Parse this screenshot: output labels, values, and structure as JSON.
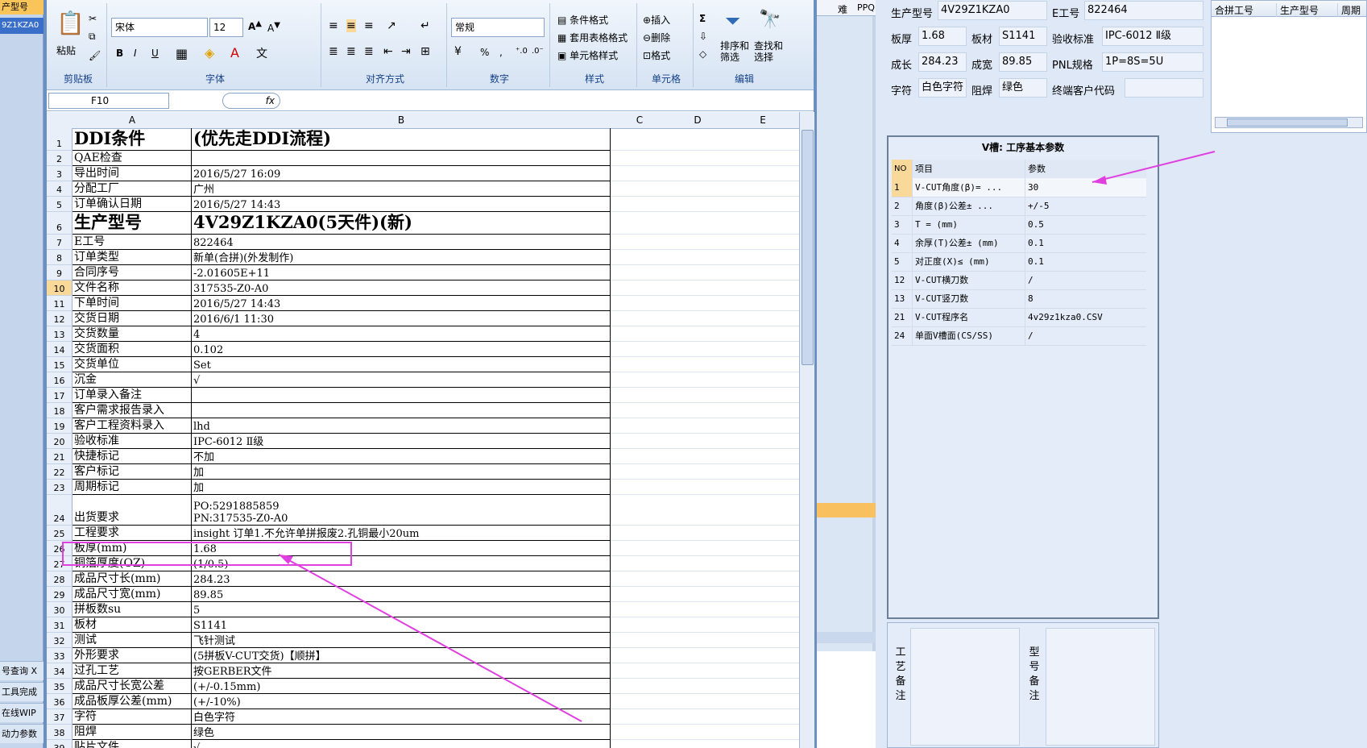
{
  "left_strip": {
    "header": "产型号",
    "selected": "9Z1KZA0",
    "buttons": [
      "号查询 X",
      "工具完成",
      "在线WIP",
      "动力参数"
    ]
  },
  "ribbon": {
    "clipboard": {
      "paste": "粘贴",
      "label": "剪贴板"
    },
    "font": {
      "name": "宋体",
      "size": "12",
      "label": "字体",
      "bold": "B",
      "italic": "I",
      "underline": "U"
    },
    "align": {
      "label": "对齐方式"
    },
    "number": {
      "format": "常规",
      "label": "数字",
      "percent": "%",
      "comma": ","
    },
    "styles": {
      "cond": "条件格式",
      "table": "套用表格格式",
      "cell": "单元格样式",
      "label": "样式"
    },
    "cells": {
      "insert": "插入",
      "delete": "删除",
      "format": "格式",
      "label": "单元格"
    },
    "edit": {
      "sort": "排序和筛选",
      "find": "查找和选择",
      "label": "编辑",
      "sigma": "Σ"
    }
  },
  "formula_bar": {
    "name_box": "F10",
    "fx": "fx"
  },
  "columns": [
    "A",
    "B",
    "C",
    "D",
    "E"
  ],
  "rows": [
    {
      "n": "1",
      "a": "DDI条件",
      "b": "(优先走DDI流程)",
      "big": true
    },
    {
      "n": "2",
      "a": "QAE检查",
      "b": ""
    },
    {
      "n": "3",
      "a": "导出时间",
      "b": "2016/5/27 16:09"
    },
    {
      "n": "4",
      "a": "分配工厂",
      "b": "广州"
    },
    {
      "n": "5",
      "a": "订单确认日期",
      "b": "2016/5/27 14:43"
    },
    {
      "n": "6",
      "a": "生产型号",
      "b": "4V29Z1KZA0(5天件)(新)",
      "big": true
    },
    {
      "n": "7",
      "a": "E工号",
      "b": "822464"
    },
    {
      "n": "8",
      "a": "订单类型",
      "b": "新单(合拼)(外发制作)"
    },
    {
      "n": "9",
      "a": "合同序号",
      "b": "-2.01605E+11"
    },
    {
      "n": "10",
      "a": "文件名称",
      "b": "317535-Z0-A0",
      "sel": true
    },
    {
      "n": "11",
      "a": "下单时间",
      "b": "2016/5/27 14:43"
    },
    {
      "n": "12",
      "a": "交货日期",
      "b": "2016/6/1 11:30"
    },
    {
      "n": "13",
      "a": "交货数量",
      "b": "4"
    },
    {
      "n": "14",
      "a": "交货面积",
      "b": "0.102"
    },
    {
      "n": "15",
      "a": "交货单位",
      "b": "Set"
    },
    {
      "n": "16",
      "a": "沉金",
      "b": "√"
    },
    {
      "n": "17",
      "a": "订单录入备注",
      "b": ""
    },
    {
      "n": "18",
      "a": "客户需求报告录入",
      "b": ""
    },
    {
      "n": "19",
      "a": "客户工程资料录入",
      "b": "lhd"
    },
    {
      "n": "20",
      "a": "验收标准",
      "b": "IPC-6012 Ⅱ级"
    },
    {
      "n": "21",
      "a": "快捷标记",
      "b": "不加"
    },
    {
      "n": "22",
      "a": "客户标记",
      "b": "加"
    },
    {
      "n": "23",
      "a": "周期标记",
      "b": "加"
    },
    {
      "n": "24",
      "a": "出货要求",
      "b": "PO:5291885859",
      "b2": " PN:317535-Z0-A0",
      "tall": true
    },
    {
      "n": "25",
      "a": "工程要求",
      "b": "insight 订单1.不允许单拼报废2.孔铜最小20um"
    },
    {
      "n": "26",
      "a": "板厚(mm)",
      "b": "1.68"
    },
    {
      "n": "27",
      "a": "铜箔厚度(OZ)",
      "b": " (1/0.5)"
    },
    {
      "n": "28",
      "a": "成品尺寸长(mm)",
      "b": "284.23"
    },
    {
      "n": "29",
      "a": "成品尺寸宽(mm)",
      "b": "89.85"
    },
    {
      "n": "30",
      "a": "拼板数su",
      "b": "5"
    },
    {
      "n": "31",
      "a": "板材",
      "b": "S1141"
    },
    {
      "n": "32",
      "a": "测试",
      "b": "飞针测试"
    },
    {
      "n": "33",
      "a": "外形要求",
      "b": "(5拼板V-CUT交货)【顺拼】"
    },
    {
      "n": "34",
      "a": "过孔工艺",
      "b": "按GERBER文件"
    },
    {
      "n": "35",
      "a": "成品尺寸长宽公差",
      "b": "(+/-0.15mm)"
    },
    {
      "n": "36",
      "a": "成品板厚公差(mm)",
      "b": "(+/-10%)"
    },
    {
      "n": "37",
      "a": "字符",
      "b": "白色字符"
    },
    {
      "n": "38",
      "a": "阻焊",
      "b": "绿色"
    },
    {
      "n": "39",
      "a": "贴片文件",
      "b": "√"
    }
  ],
  "mid": {
    "h1": "难",
    "h2": "PPQ"
  },
  "info": {
    "model_label": "生产型号",
    "model_value": "4V29Z1KZA0",
    "e_label": "E工号",
    "e_value": "822464",
    "thick_label": "板厚",
    "thick_value": "1.68",
    "mat_label": "板材",
    "mat_value": "S1141",
    "std_label": "验收标准",
    "std_value": "IPC-6012 Ⅱ级",
    "len_label": "成长",
    "len_value": "284.23",
    "wid_label": "成宽",
    "wid_value": "89.85",
    "pnl_label": "PNL规格",
    "pnl_value": "1P=8S=5U",
    "char_label": "字符",
    "char_value": "白色字符",
    "mask_label": "阻焊",
    "mask_value": "绿色",
    "cust_label": "终端客户代码",
    "cust_value": ""
  },
  "merge_panel": {
    "headers": [
      "合拼工号",
      "生产型号",
      "周期"
    ]
  },
  "vcut": {
    "title": "V槽: 工序基本参数",
    "headers": {
      "no": "NO",
      "item": "项目",
      "val": "参数"
    },
    "rows": [
      {
        "no": "1",
        "item": "V-CUT角度(β)=  ...",
        "val": "30"
      },
      {
        "no": "2",
        "item": "角度(β)公差±  ...",
        "val": "+/-5"
      },
      {
        "no": "3",
        "item": "T =  (mm)",
        "val": "0.5"
      },
      {
        "no": "4",
        "item": "余厚(T)公差±  (mm)",
        "val": "0.1"
      },
      {
        "no": "5",
        "item": "对正度(X)≤ (mm)",
        "val": "0.1"
      },
      {
        "no": "12",
        "item": "V-CUT横刀数",
        "val": "/"
      },
      {
        "no": "13",
        "item": "V-CUT竖刀数",
        "val": "8"
      },
      {
        "no": "21",
        "item": "V-CUT程序名",
        "val": "4v29z1kza0.CSV"
      },
      {
        "no": "24",
        "item": "单面V槽面(CS/SS)",
        "val": "/"
      }
    ]
  },
  "notes": {
    "process_label": "工艺备注",
    "model_label": "型号备注"
  },
  "colors": {
    "annotation": "#e040e0",
    "selected_row": "#f9d99a",
    "accent": "#6b8fc0"
  }
}
